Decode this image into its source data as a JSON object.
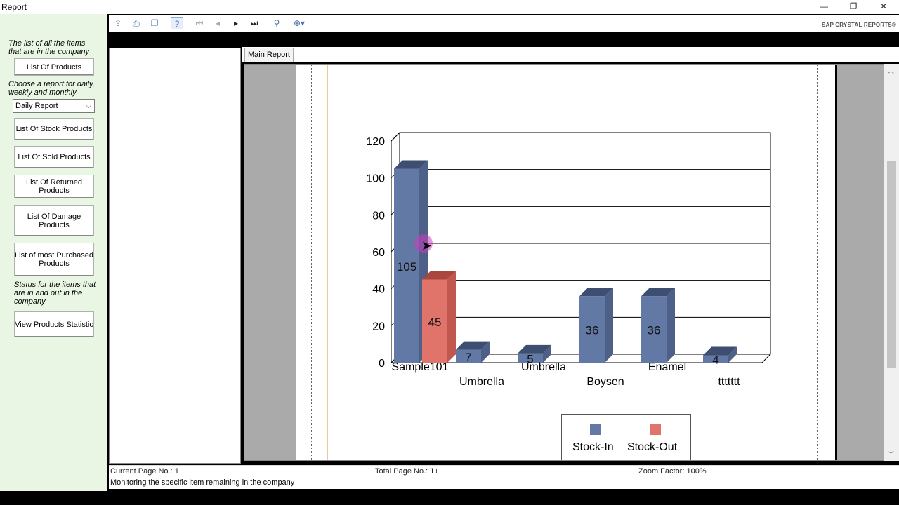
{
  "window": {
    "title": "Report",
    "minimize": "—",
    "restore": "❐",
    "close": "✕"
  },
  "left_panel": {
    "note1": "The list of all the items that are in the company",
    "btn_products": "List Of Products",
    "note2": "Choose a report for daily, weekly and monthly",
    "report_select": "Daily Report",
    "btn_stock": "List Of Stock Products",
    "btn_sold": "List Of Sold Products",
    "btn_returned": "List Of Returned Products",
    "btn_damage": "List Of Damage Products",
    "btn_most": "List of most Purchased Products",
    "note3": "Status for the items that are in and out in the company",
    "btn_statistic": "View Products Statistic"
  },
  "toolbar": {
    "brand": "SAP CRYSTAL REPORTS®",
    "icons": [
      "export-icon",
      "print-icon",
      "copy-icon",
      "toggle-group-tree-icon",
      "first-page-icon",
      "previous-page-icon",
      "next-page-icon",
      "last-page-icon",
      "find-icon",
      "zoom-icon"
    ]
  },
  "tabs": {
    "main": "Main Report"
  },
  "status": {
    "current_page": "Current Page No.: 1",
    "total_page": "Total Page No.: 1+",
    "zoom": "Zoom Factor: 100%",
    "hint": "Monitoring the specific item remaining in the company"
  },
  "chart_data": {
    "type": "bar",
    "categories": [
      "Sample101",
      "Umbrella",
      "Umbrella",
      "Boysen",
      "Enamel",
      "ttttttt"
    ],
    "series": [
      {
        "name": "Stock-In",
        "values": [
          105,
          7,
          5,
          36,
          36,
          4
        ],
        "color": "#6279a6"
      },
      {
        "name": "Stock-Out",
        "values": [
          45,
          null,
          null,
          null,
          null,
          null
        ],
        "color": "#e0746a"
      }
    ],
    "ylim": [
      0,
      120
    ],
    "yticks": [
      "0",
      "20",
      "40",
      "60",
      "80",
      "100",
      "120"
    ],
    "grid": true,
    "legend": "bottom"
  }
}
